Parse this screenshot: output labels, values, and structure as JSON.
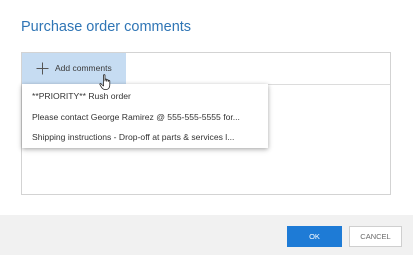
{
  "dialog": {
    "title": "Purchase order comments"
  },
  "toolbar": {
    "add_comments_label": "Add comments",
    "add_icon": "plus-icon"
  },
  "dropdown": {
    "items": [
      {
        "label": "**PRIORITY** Rush order"
      },
      {
        "label": "Please contact George Ramirez @ 555-555-5555 for..."
      },
      {
        "label": "Shipping instructions - Drop-off at parts & services l..."
      }
    ]
  },
  "footer": {
    "ok_label": "OK",
    "cancel_label": "CANCEL"
  },
  "colors": {
    "title": "#2f75b5",
    "add_button_bg": "#c6dcf2",
    "ok_button_bg": "#1e7bd6",
    "footer_bg": "#f1f1f1"
  }
}
